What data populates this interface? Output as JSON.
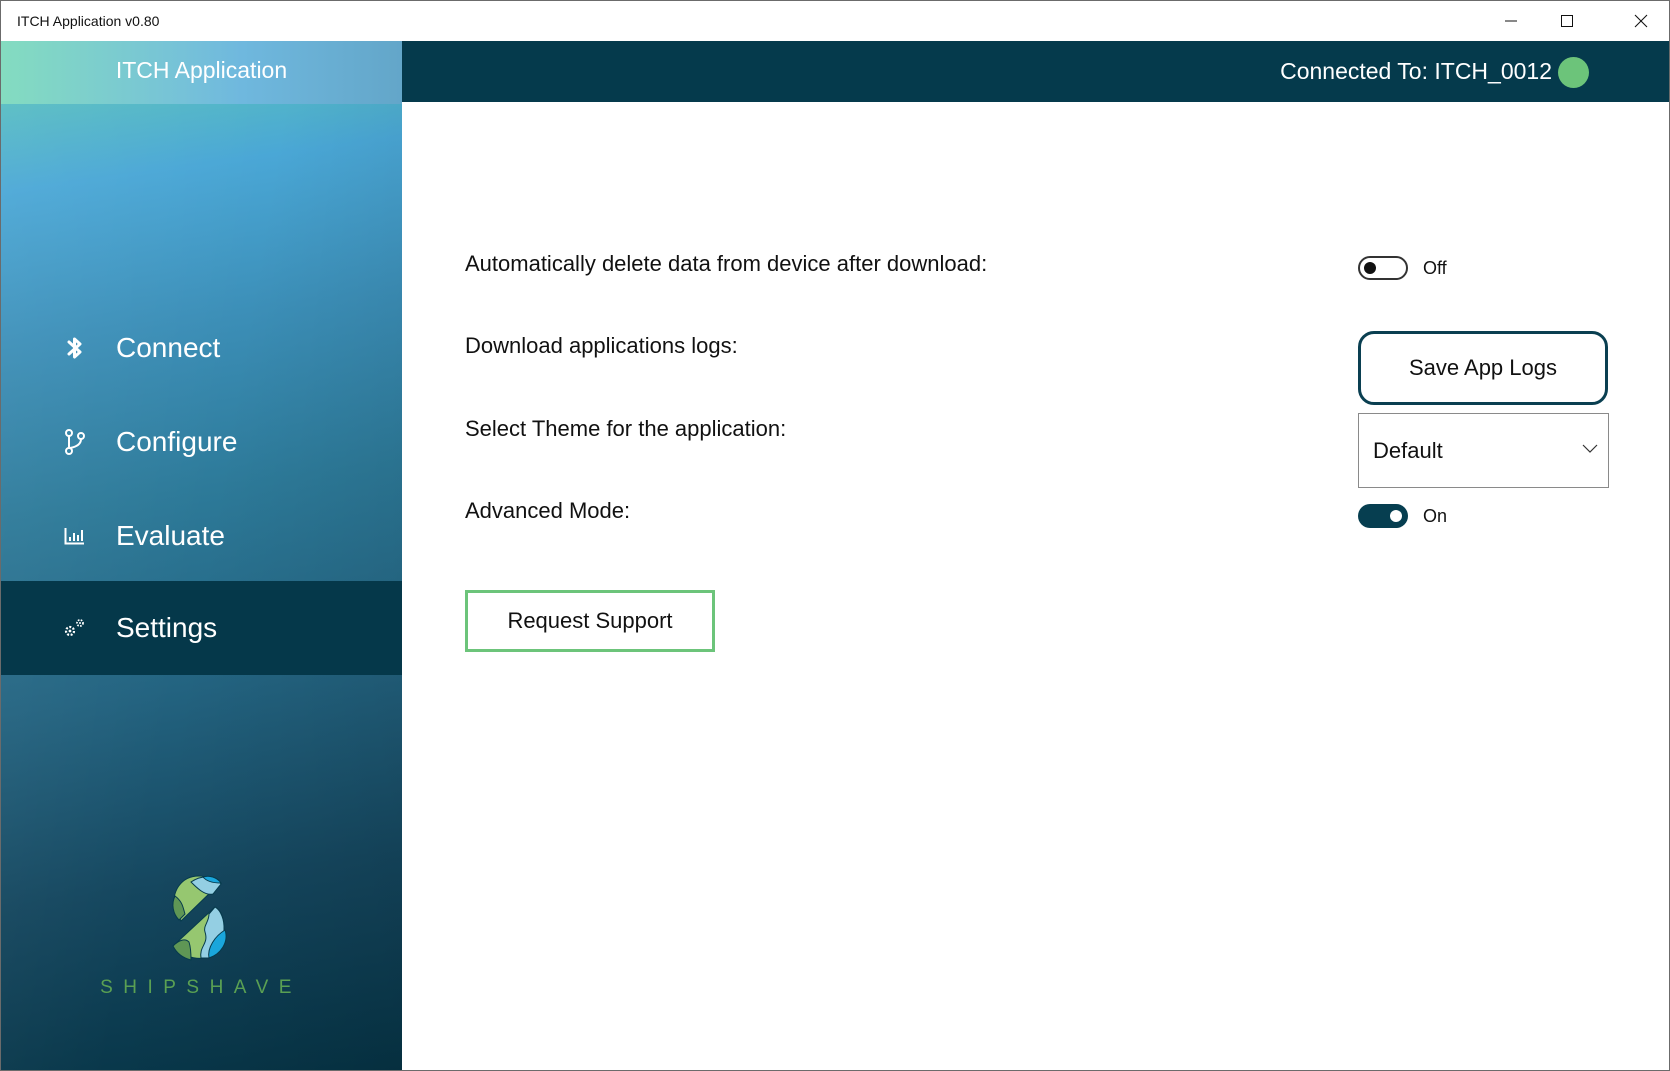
{
  "window": {
    "title": "ITCH Application v0.80",
    "controls": {
      "minimize": "minimize-icon",
      "maximize": "maximize-icon",
      "close": "close-icon"
    }
  },
  "sidebar": {
    "brand_title": "ITCH Application",
    "items": [
      {
        "label": "Connect",
        "icon": "bluetooth-icon",
        "active": false
      },
      {
        "label": "Configure",
        "icon": "branch-icon",
        "active": false
      },
      {
        "label": "Evaluate",
        "icon": "bar-chart-icon",
        "active": false
      },
      {
        "label": "Settings",
        "icon": "gears-icon",
        "active": true
      }
    ],
    "logo_text": "SHIPSHAVE"
  },
  "header": {
    "connection_text": "Connected To: ITCH_0012",
    "status": "connected",
    "status_color": "#6cc47a"
  },
  "settings": {
    "auto_delete": {
      "label": "Automatically delete data from device after download:",
      "state": "Off",
      "value": false
    },
    "download_logs": {
      "label": "Download applications logs:",
      "button": "Save App Logs"
    },
    "theme": {
      "label": "Select Theme for the application:",
      "selected": "Default"
    },
    "advanced_mode": {
      "label": "Advanced Mode:",
      "state": "On",
      "value": true
    },
    "request_support": "Request Support"
  },
  "colors": {
    "header_bg": "#053a4c",
    "active_nav_bg": "#05384a",
    "accent_green": "#6cc47a",
    "toggle_on": "#063e50"
  }
}
